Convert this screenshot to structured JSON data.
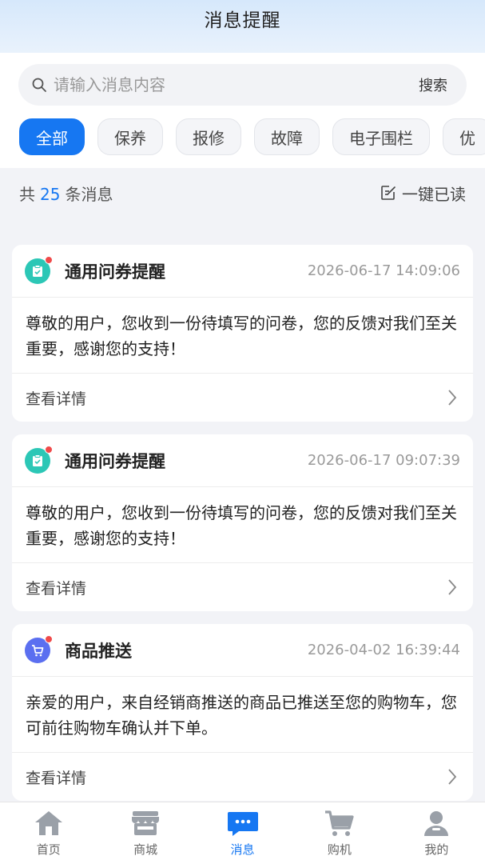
{
  "header": {
    "title": "消息提醒"
  },
  "search": {
    "placeholder": "请输入消息内容",
    "value": "",
    "button_label": "搜索"
  },
  "tabs": [
    {
      "label": "全部",
      "active": true
    },
    {
      "label": "保养"
    },
    {
      "label": "报修"
    },
    {
      "label": "故障"
    },
    {
      "label": "电子围栏"
    },
    {
      "label": "优"
    }
  ],
  "summary": {
    "prefix": "共",
    "count": "25",
    "suffix": "条消息",
    "read_all_label": "一键已读"
  },
  "messages": [
    {
      "icon": "clipboard-check-icon",
      "icon_color": "#2cc7b6",
      "title": "通用问券提醒",
      "time": "2026-06-17 14:09:06",
      "body": "尊敬的用户，您收到一份待填写的问卷，您的反馈对我们至关重要，感谢您的支持！",
      "link_label": "查看详情"
    },
    {
      "icon": "clipboard-check-icon",
      "icon_color": "#2cc7b6",
      "title": "通用问券提醒",
      "time": "2026-06-17 09:07:39",
      "body": "尊敬的用户，您收到一份待填写的问卷，您的反馈对我们至关重要，感谢您的支持！",
      "link_label": "查看详情"
    },
    {
      "icon": "cart-icon",
      "icon_color": "#5b6ff0",
      "title": "商品推送",
      "time": "2026-04-02 16:39:44",
      "body": "亲爱的用户，来自经销商推送的商品已推送至您的购物车，您可前往购物车确认并下单。",
      "link_label": "查看详情"
    }
  ],
  "nav": [
    {
      "label": "首页",
      "icon": "home-icon"
    },
    {
      "label": "商城",
      "icon": "store-icon"
    },
    {
      "label": "消息",
      "icon": "message-icon",
      "active": true
    },
    {
      "label": "购机",
      "icon": "cart-icon"
    },
    {
      "label": "我的",
      "icon": "user-icon"
    }
  ],
  "colors": {
    "accent": "#1677f2",
    "badge": "#f04a4a",
    "nav_inactive": "#9aa0a8"
  }
}
